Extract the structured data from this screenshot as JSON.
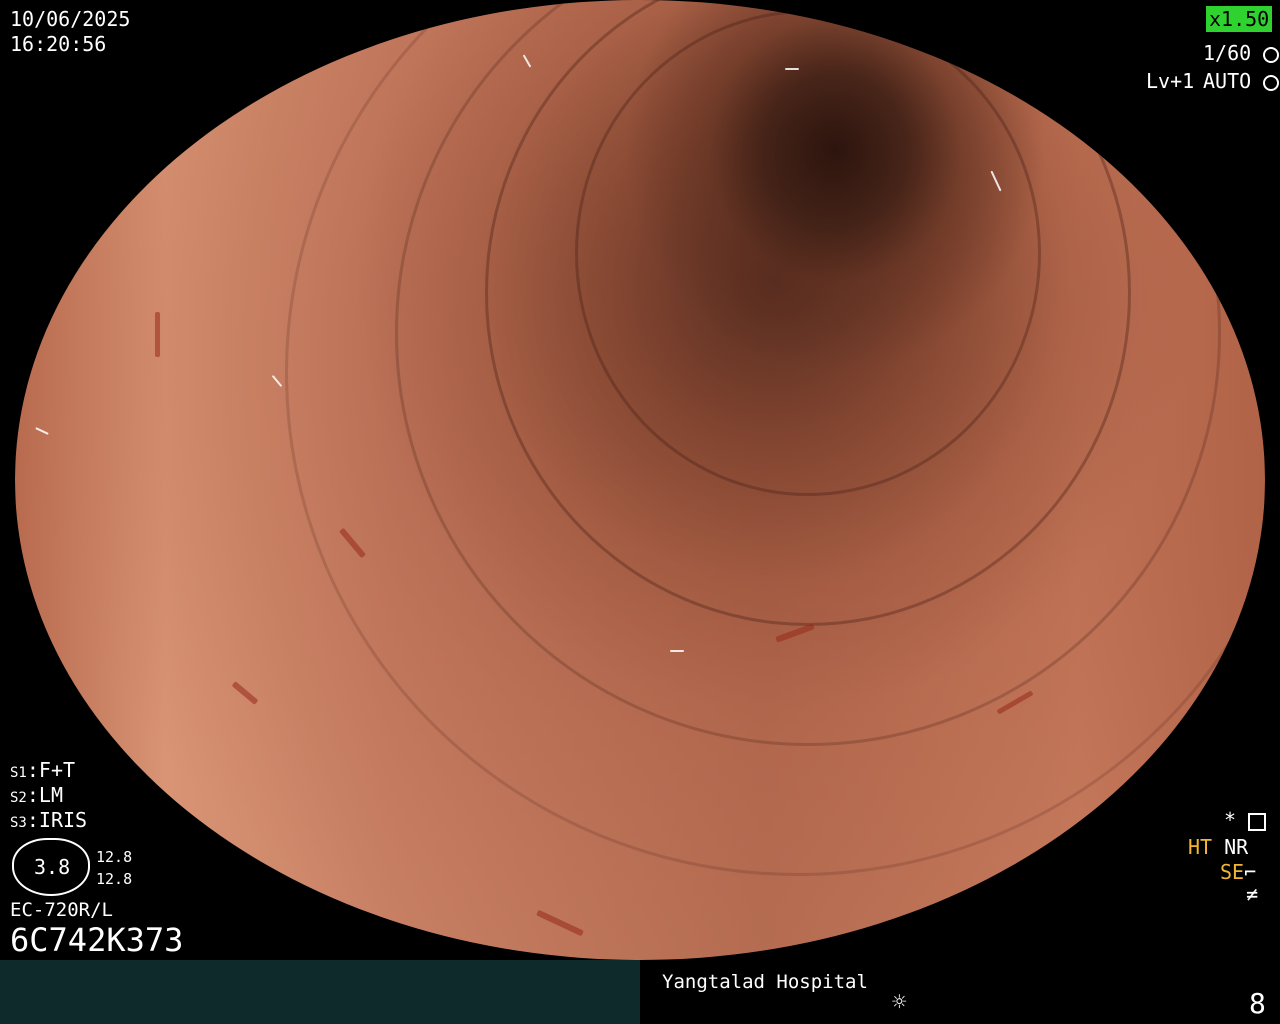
{
  "datetime": {
    "date": "10/06/2025",
    "time": "16:20:56"
  },
  "zoom": "x1.50",
  "shutter": "1/60",
  "level": "Lv+1",
  "iris_mode": "AUTO",
  "switches": [
    {
      "key": "S1",
      "value": "F+T"
    },
    {
      "key": "S2",
      "value": "LM"
    },
    {
      "key": "S3",
      "value": "IRIS"
    }
  ],
  "tip": {
    "main": "3.8",
    "upper": "12.8",
    "lower": "12.8"
  },
  "scope_model": "EC-720R/L",
  "serial": "6C742K373",
  "right_indicators": {
    "star": "*",
    "ht": "HT",
    "nr": "NR",
    "se": "SE"
  },
  "hospital": "Yangtalad Hospital",
  "frame_number": "8",
  "colors": {
    "zoom_bg": "#2fd22f",
    "ht_color": "#f2b632",
    "se_color": "#f2b632",
    "bottom_bar": "#0e2a2b"
  }
}
